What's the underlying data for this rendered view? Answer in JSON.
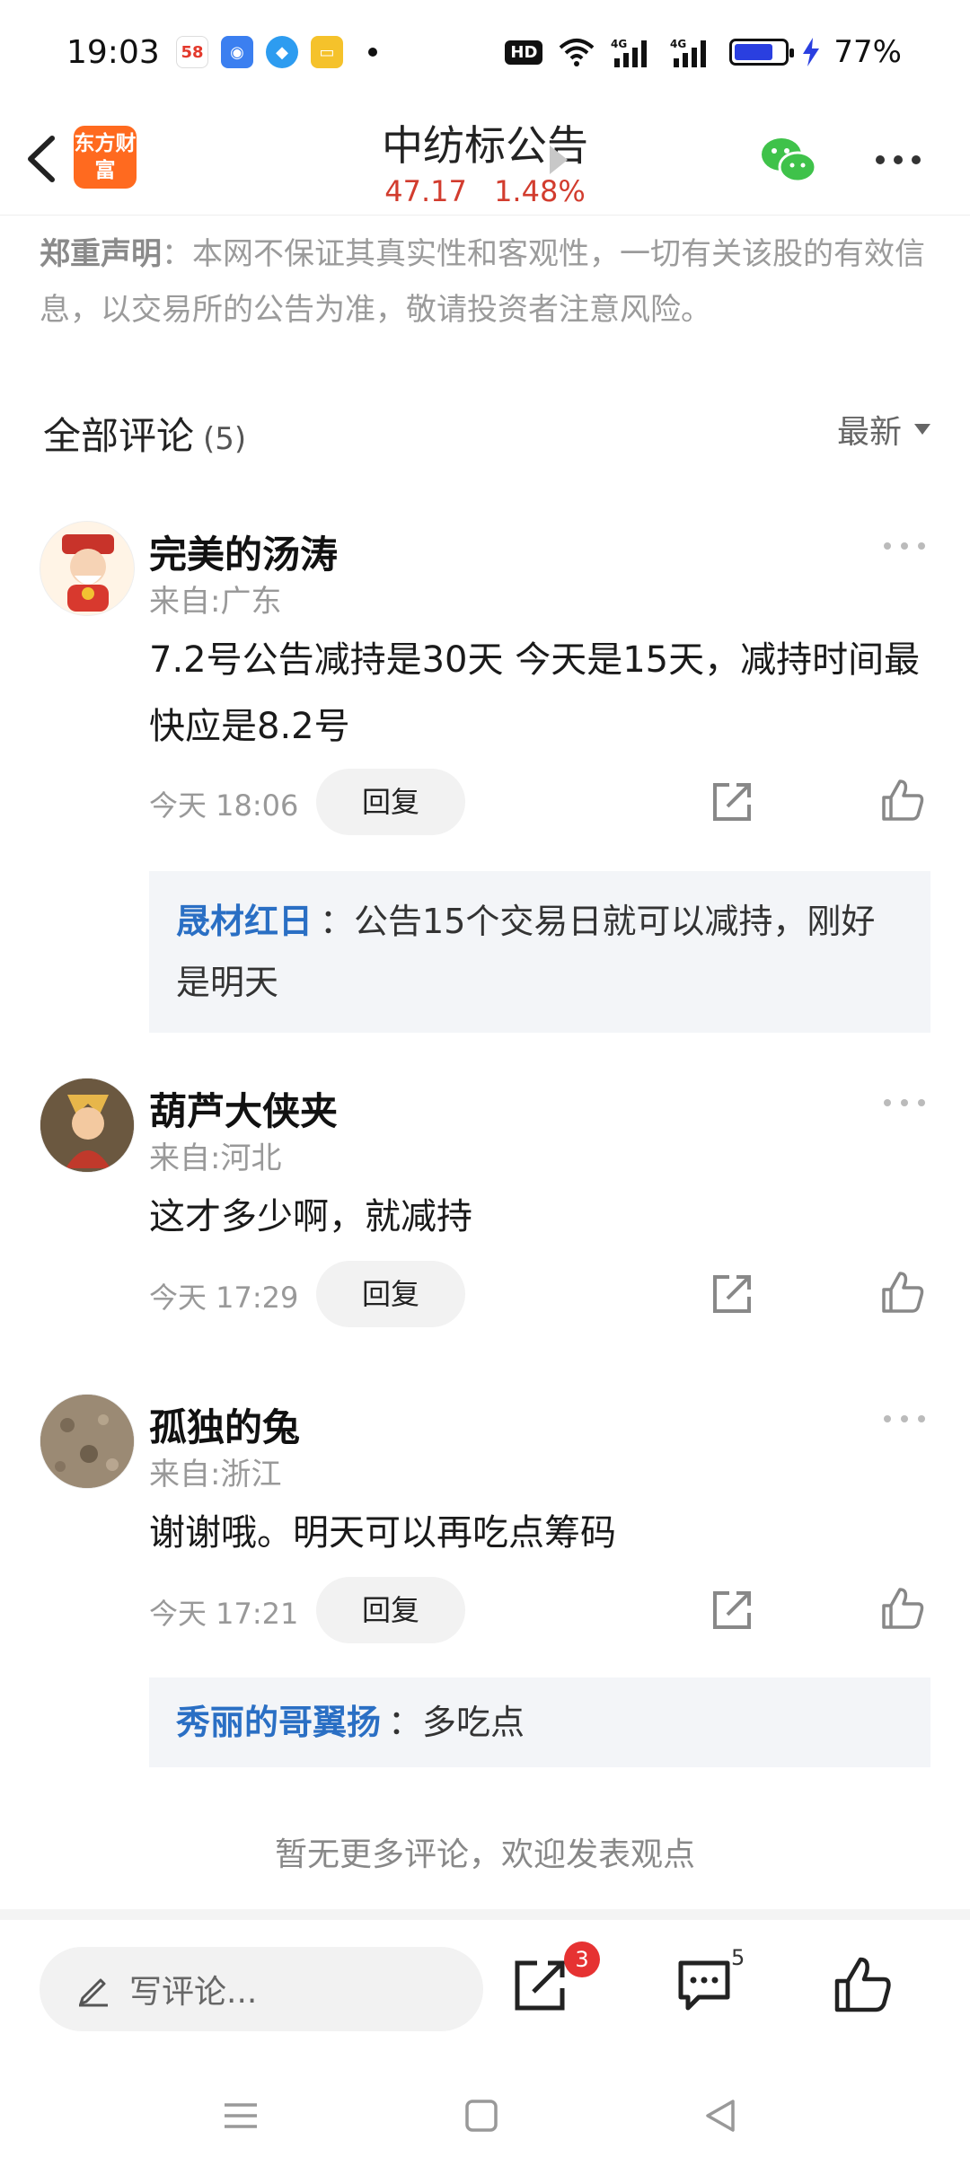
{
  "status_bar": {
    "time": "19:03",
    "app_icon_1_text": "58",
    "network_labels": [
      "4G",
      "4G"
    ],
    "hd_label": "HD",
    "battery": "77%",
    "battery_level": 0.77
  },
  "header": {
    "brand_logo_text": "东方财富",
    "title": "中纺标公告",
    "price": "47.17",
    "change": "1.48%"
  },
  "disclaimer": {
    "label": "郑重声明",
    "text": "：本网不保证其真实性和客观性，一切有关该股的有效信息，以交易所的公告为准，敬请投资者注意风险。"
  },
  "comments_section": {
    "title": "全部评论",
    "count": "(5)",
    "sort_label": "最新"
  },
  "comments": [
    {
      "name": "完美的汤涛",
      "location": "来自:广东",
      "text": "7.2号公告减持是30天 今天是15天，减持时间最快应是8.2号",
      "time": "今天 18:06",
      "reply_label": "回复",
      "sub_reply": {
        "name": "晟材红日",
        "text": "：公告15个交易日就可以减持，刚好是明天"
      }
    },
    {
      "name": "葫芦大侠夹",
      "location": "来自:河北",
      "text": "这才多少啊，就减持",
      "time": "今天 17:29",
      "reply_label": "回复"
    },
    {
      "name": "孤独的兔",
      "location": "来自:浙江",
      "text": "谢谢哦。明天可以再吃点筹码",
      "time": "今天 17:21",
      "reply_label": "回复",
      "sub_reply": {
        "name": "秀丽的哥翼扬",
        "text": "：多吃点"
      }
    }
  ],
  "footer_note": "暂无更多评论，欢迎发表观点",
  "bottom_bar": {
    "write_placeholder": "写评论...",
    "share_badge": "3",
    "comment_count": "5"
  },
  "icons": {
    "back": "chevron-left-icon",
    "wechat": "wechat-icon",
    "more": "more-dots-icon",
    "share": "share-external-icon",
    "like": "thumbs-up-icon",
    "pencil": "pencil-icon",
    "comment": "comment-bubble-icon"
  },
  "colors": {
    "price_red": "#d23c2e",
    "brand_orange": "#ff6a1f",
    "link_blue": "#2a6fc4",
    "badge_red": "#e63232"
  }
}
